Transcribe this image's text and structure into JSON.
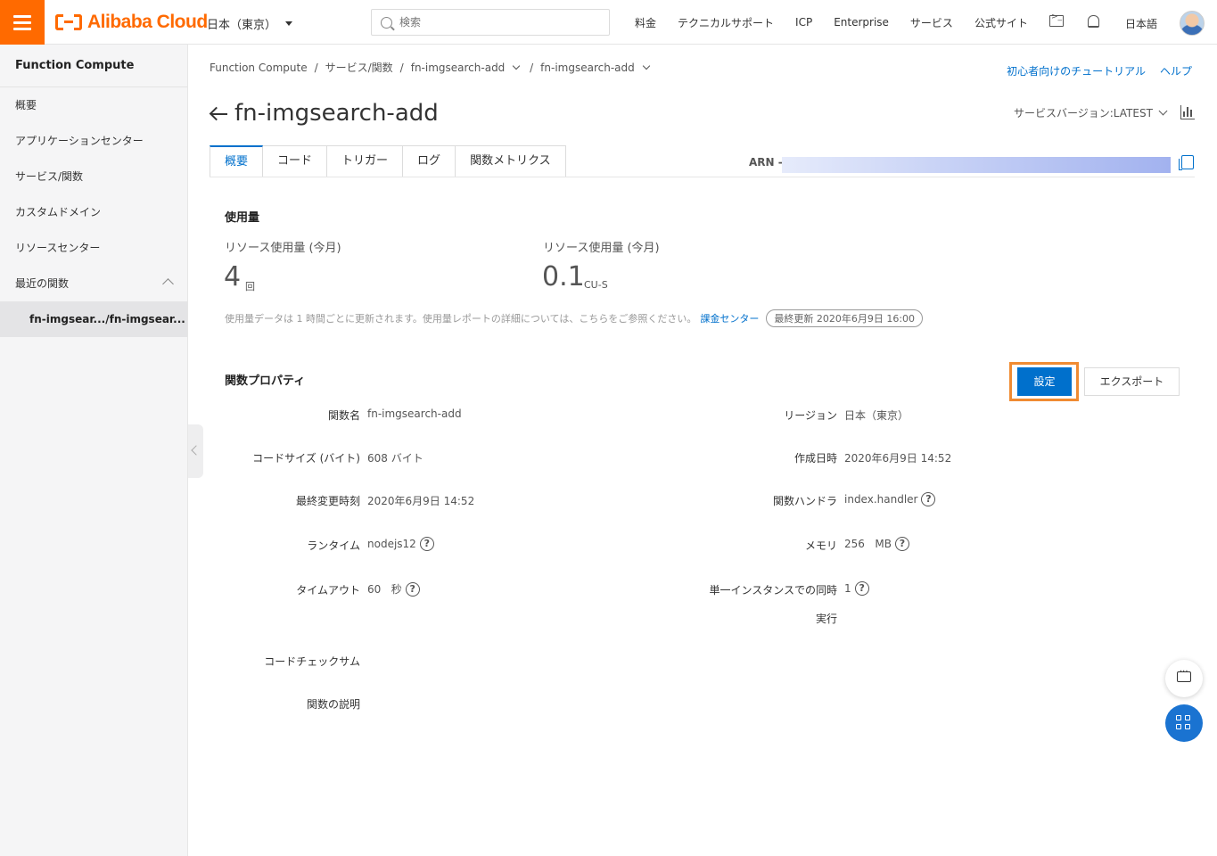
{
  "topbar": {
    "brand": "Alibaba Cloud",
    "region": "日本（東京）",
    "search_placeholder": "検索",
    "nav": [
      "料金",
      "テクニカルサポート",
      "ICP",
      "Enterprise",
      "サービス",
      "公式サイト"
    ],
    "language": "日本語"
  },
  "sidebar": {
    "title": "Function Compute",
    "items": [
      "概要",
      "アプリケーションセンター",
      "サービス/関数",
      "カスタムドメイン",
      "リソースセンター",
      "最近の関数"
    ],
    "recent": "fn-imgsear.../fn-imgsear..."
  },
  "breadcrumb": [
    "Function Compute",
    "サービス/関数",
    "fn-imgsearch-add",
    "fn-imgsearch-add"
  ],
  "help_links": [
    "初心者向けのチュートリアル",
    "ヘルプ"
  ],
  "page": {
    "title": "fn-imgsearch-add",
    "version": "サービスバージョン:LATEST",
    "arn_label": "ARN -"
  },
  "tabs": [
    "概要",
    "コード",
    "トリガー",
    "ログ",
    "関数メトリクス"
  ],
  "usage": {
    "title": "使用量",
    "metrics": [
      {
        "label": "リソース使用量 (今月)",
        "value": "4",
        "unit": "回"
      },
      {
        "label": "リソース使用量 (今月)",
        "value": "0.1",
        "unit": "CU-S"
      }
    ],
    "note": "使用量データは 1 時間ごとに更新されます。使用量レポートの詳細については、こちらをご参照ください。",
    "note_link": "課金センター",
    "last_updated": "最終更新  2020年6月9日 16:00"
  },
  "properties": {
    "title": "関数プロパティ",
    "settings_button": "設定",
    "export_button": "エクスポート",
    "left": [
      {
        "label": "関数名",
        "value": "fn-imgsearch-add",
        "help": false
      },
      {
        "label": "コードサイズ (バイト)",
        "value": "608 バイト",
        "help": false
      },
      {
        "label": "最終変更時刻",
        "value": "2020年6月9日 14:52",
        "help": false
      },
      {
        "label": "ランタイム",
        "value": "nodejs12",
        "help": true
      },
      {
        "label": "タイムアウト",
        "value": "60   秒",
        "help": true
      },
      {
        "label": "コードチェックサム",
        "value": "",
        "help": false
      },
      {
        "label": "関数の説明",
        "value": "",
        "help": false
      }
    ],
    "right": [
      {
        "label": "リージョン",
        "value": "日本（東京）",
        "help": false
      },
      {
        "label": "作成日時",
        "value": "2020年6月9日 14:52",
        "help": false
      },
      {
        "label": "関数ハンドラ",
        "value": "index.handler",
        "help": true
      },
      {
        "label": "メモリ",
        "value": "256   MB",
        "help": true
      },
      {
        "label": "単一インスタンスでの同時",
        "label2": "実行",
        "value": "1",
        "help": true
      }
    ]
  },
  "colors": {
    "brand": "#ff6a00",
    "primary": "#0070cc",
    "highlight": "#f08b32"
  }
}
